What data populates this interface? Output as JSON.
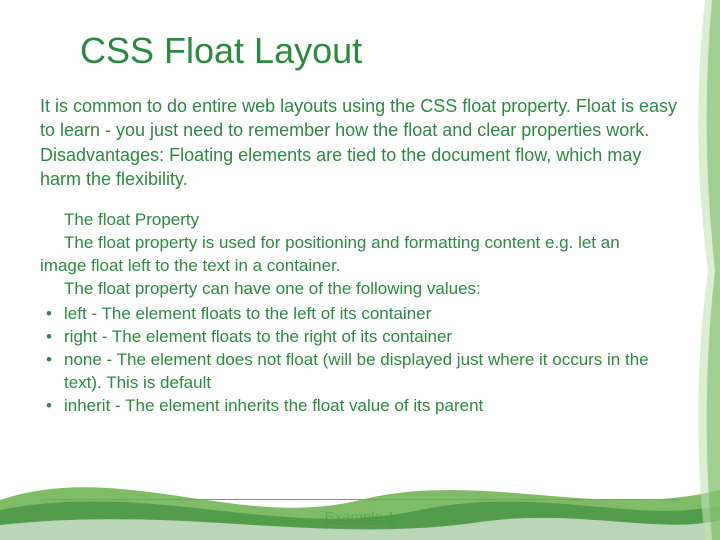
{
  "title": "CSS Float Layout",
  "intro": "It is common to do entire web layouts using the CSS float property. Float is easy to learn - you just need to remember how the float and clear properties work. Disadvantages: Floating elements are tied to the document flow, which may harm the flexibility.",
  "section": {
    "heading": "The float Property",
    "desc_line1": "The float property is used for positioning and formatting content e.g. let an",
    "desc_line2": "image float left to the text in a container.",
    "values_intro": "The float property can have one of the following values:",
    "values": [
      "left - The element floats to the left of its container",
      "right - The element floats to the right of its container",
      "none - The element does not float (will be displayed just where it occurs in the text). This is default",
      "inherit - The element inherits the float value of its parent"
    ]
  },
  "footer": {
    "link": "Example 1"
  }
}
